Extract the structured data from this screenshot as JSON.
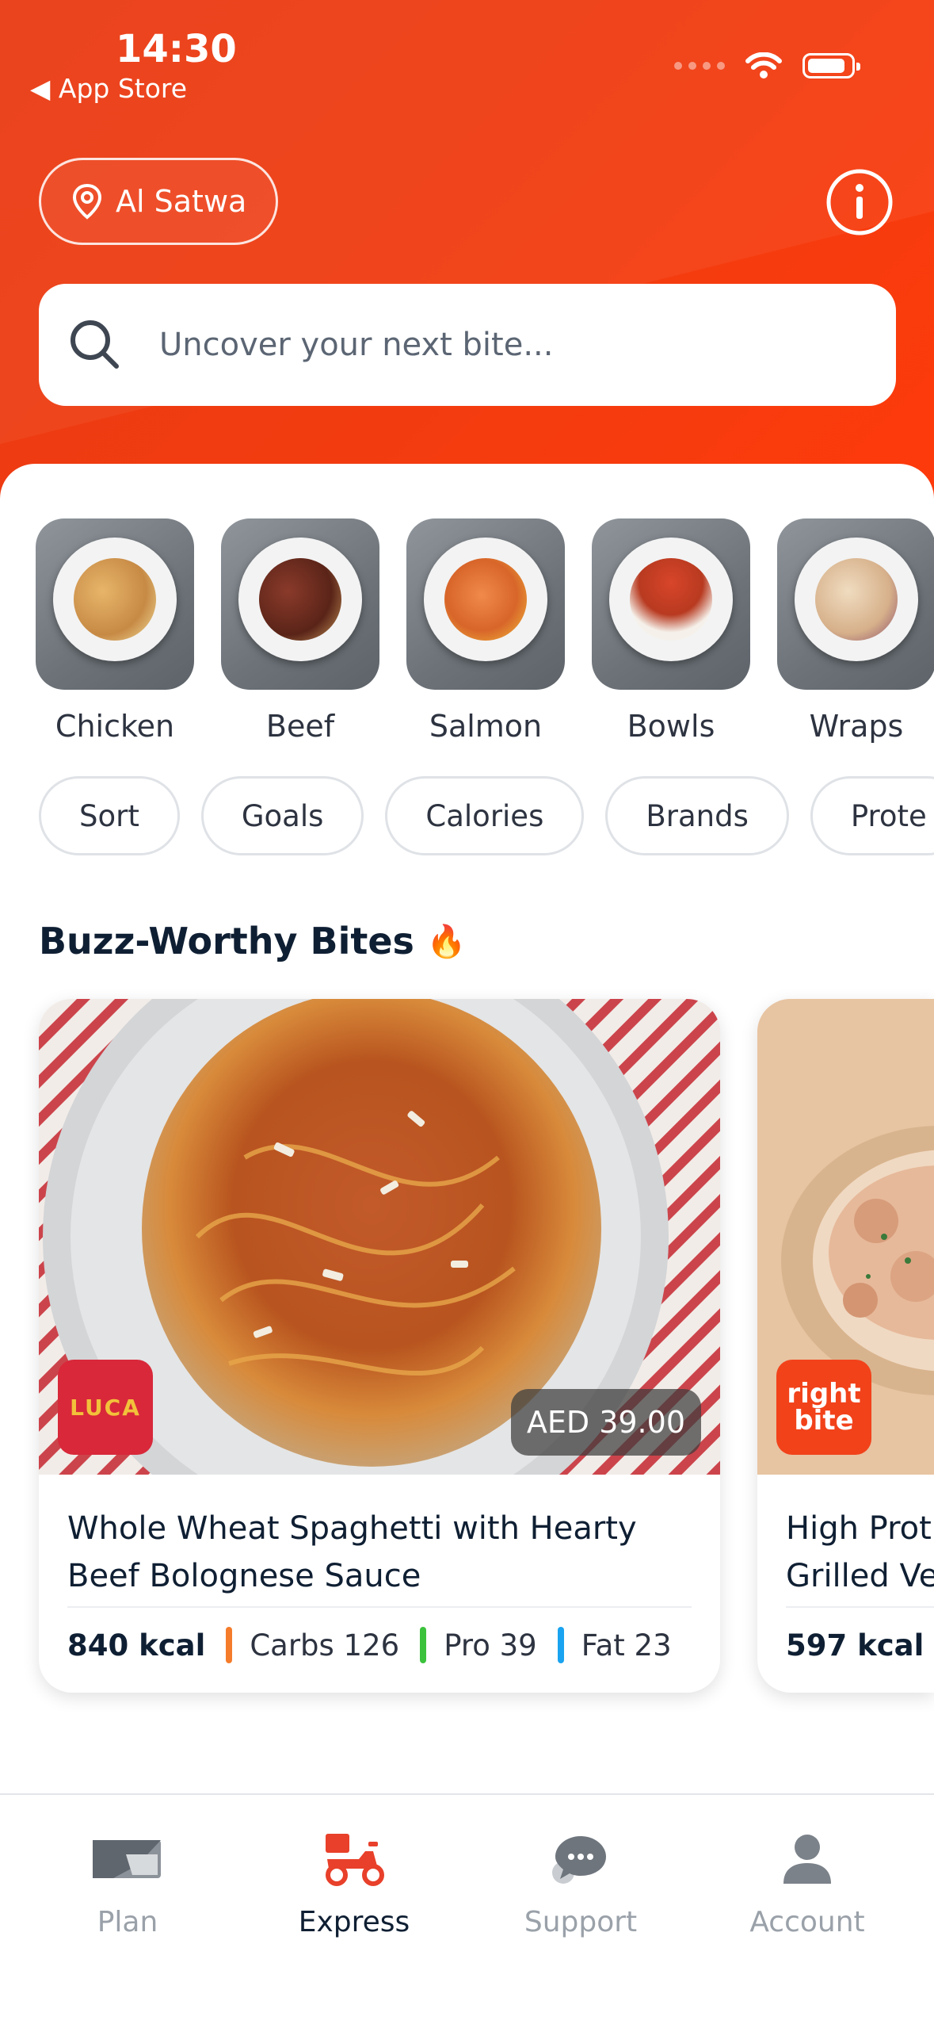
{
  "status_bar": {
    "time": "14:30",
    "back_label": "◀ App Store"
  },
  "header": {
    "location": "Al Satwa",
    "search_placeholder": "Uncover your next bite..."
  },
  "categories": [
    {
      "label": "Chicken",
      "food_color": "#d9a25a"
    },
    {
      "label": "Beef",
      "food_color": "#7a3a2a"
    },
    {
      "label": "Salmon",
      "food_color": "#e07a3a"
    },
    {
      "label": "Bowls",
      "food_color": "#c7452a"
    },
    {
      "label": "Wraps",
      "food_color": "#e6c9a8"
    }
  ],
  "filters": [
    "Sort",
    "Goals",
    "Calories",
    "Brands",
    "Prote"
  ],
  "section": {
    "title": "Buzz-Worthy Bites",
    "emoji": "🔥"
  },
  "cards": [
    {
      "brand": "LUCA",
      "price": "AED 39.00",
      "title": "Whole Wheat Spaghetti with Hearty Beef Bolognese Sauce",
      "kcal": "840 kcal",
      "carbs": "Carbs 126",
      "pro": "Pro 39",
      "fat": "Fat 23"
    },
    {
      "brand_line1": "right",
      "brand_line2": "bite",
      "title": "High Prot Grilled Ve",
      "title_line1": "High Prot",
      "title_line2": "Grilled Ve",
      "kcal": "597 kcal"
    }
  ],
  "colors": {
    "accent": "#f23c10",
    "carbs": "#f57c2b",
    "pro": "#3cc23c",
    "fat": "#1aa3f0"
  },
  "tabs": [
    {
      "label": "Plan",
      "icon": "plan-icon"
    },
    {
      "label": "Express",
      "icon": "scooter-icon",
      "active": true
    },
    {
      "label": "Support",
      "icon": "chat-bubbles-icon"
    },
    {
      "label": "Account",
      "icon": "person-icon"
    }
  ]
}
